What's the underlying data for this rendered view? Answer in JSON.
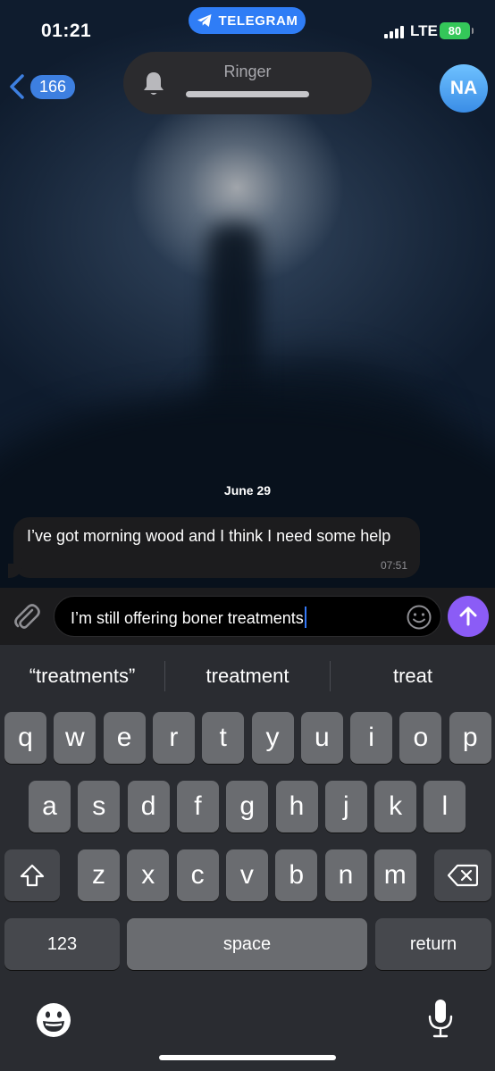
{
  "status_bar": {
    "time": "01:21",
    "app_pill": "TELEGRAM",
    "network": "LTE",
    "battery": "80"
  },
  "header": {
    "unread_count": "166",
    "ringer_label": "Ringer",
    "avatar_initials": "NA"
  },
  "chat": {
    "date_separator": "June 29",
    "messages": [
      {
        "text": "I’ve got morning wood and I think I need some help",
        "time": "07:51",
        "direction": "incoming"
      }
    ]
  },
  "composer": {
    "text": "I’m still offering boner treatments"
  },
  "keyboard": {
    "suggestions": [
      "“treatments”",
      "treatment",
      "treat"
    ],
    "row1": [
      "q",
      "w",
      "e",
      "r",
      "t",
      "y",
      "u",
      "i",
      "o",
      "p"
    ],
    "row2": [
      "a",
      "s",
      "d",
      "f",
      "g",
      "h",
      "j",
      "k",
      "l"
    ],
    "row3": [
      "z",
      "x",
      "c",
      "v",
      "b",
      "n",
      "m"
    ],
    "numbers_label": "123",
    "space_label": "space",
    "return_label": "return"
  },
  "colors": {
    "accent": "#2f7df6",
    "send": "#8b5cf6",
    "battery": "#34c759"
  }
}
